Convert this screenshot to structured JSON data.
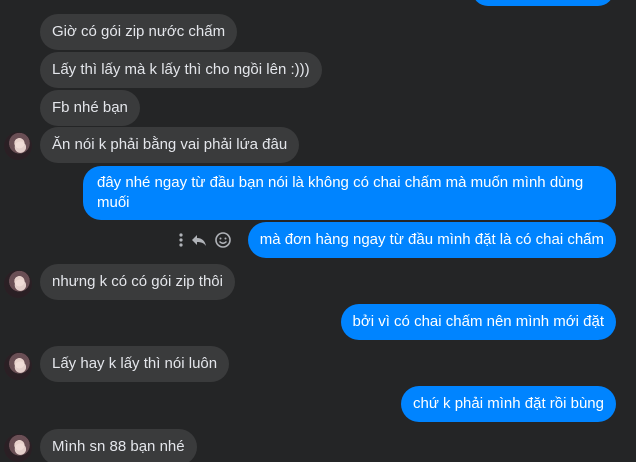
{
  "messages": {
    "m1": "Giờ có gói zip nước chấm",
    "m2": "Lấy thì lấy mà k lấy thì cho ngồi lên :)))",
    "m3": "Fb nhé bạn",
    "m4": "Ăn nói k phải bằng vai phải lứa đâu",
    "m5_line1": "đây nhé ngay từ đầu bạn nói là không có chai chấm mà muốn mình dùng",
    "m5_line2": "muối",
    "m6": "mà đơn hàng ngay từ đầu mình đặt là có chai chấm",
    "m7": "nhưng k có có gói zip thôi",
    "m8": "bởi vì có chai chấm nên mình mới đặt",
    "m9": "Lấy hay k lấy thì nói luôn",
    "m10": "chứ k phải mình đặt rồi bùng",
    "m11": "Mình sn 88 bạn nhé"
  },
  "icons": {
    "more": "more-vertical-icon",
    "reply": "reply-icon",
    "react": "smiley-icon"
  },
  "colors": {
    "background": "#242526",
    "incoming_bubble": "#3a3b3c",
    "outgoing_bubble": "#0084ff",
    "incoming_text": "#e4e6eb",
    "outgoing_text": "#ffffff"
  }
}
